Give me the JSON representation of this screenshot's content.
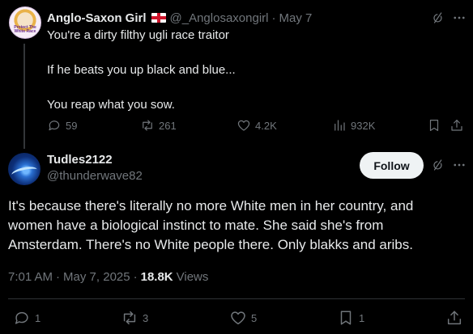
{
  "reply": {
    "name": "Anglo-Saxon Girl",
    "flag_icon": "england-flag-icon",
    "handle": "@_Anglosaxongirl",
    "separator": "·",
    "date": "May 7",
    "avatar_text": [
      "Protect The",
      "White Race"
    ],
    "lines": [
      "You're a dirty filthy ugli race traitor",
      "If he beats you up black and blue...",
      "You reap what you sow."
    ],
    "actions": {
      "replies": "59",
      "reposts": "261",
      "likes": "4.2K",
      "views": "932K"
    }
  },
  "main": {
    "name": "Tudles2122",
    "handle": "@thunderwave82",
    "follow_label": "Follow",
    "text_lines": [
      "It's because there's literally no more White men in her country, and",
      "women have a biological instinct to mate. She said she's from",
      "Amsterdam. There's no White people there. Only blakks and aribs."
    ],
    "time": "7:01 AM",
    "separator": "·",
    "date": "May 7, 2025",
    "views_count": "18.8K",
    "views_label": "Views",
    "actions": {
      "replies": "1",
      "reposts": "3",
      "likes": "5",
      "bookmarks": "1"
    }
  },
  "colors": {
    "background": "#000000",
    "text": "#e7e9ea",
    "muted": "#71767b",
    "divider": "#2f3336",
    "follow_bg": "#eff3f4"
  }
}
